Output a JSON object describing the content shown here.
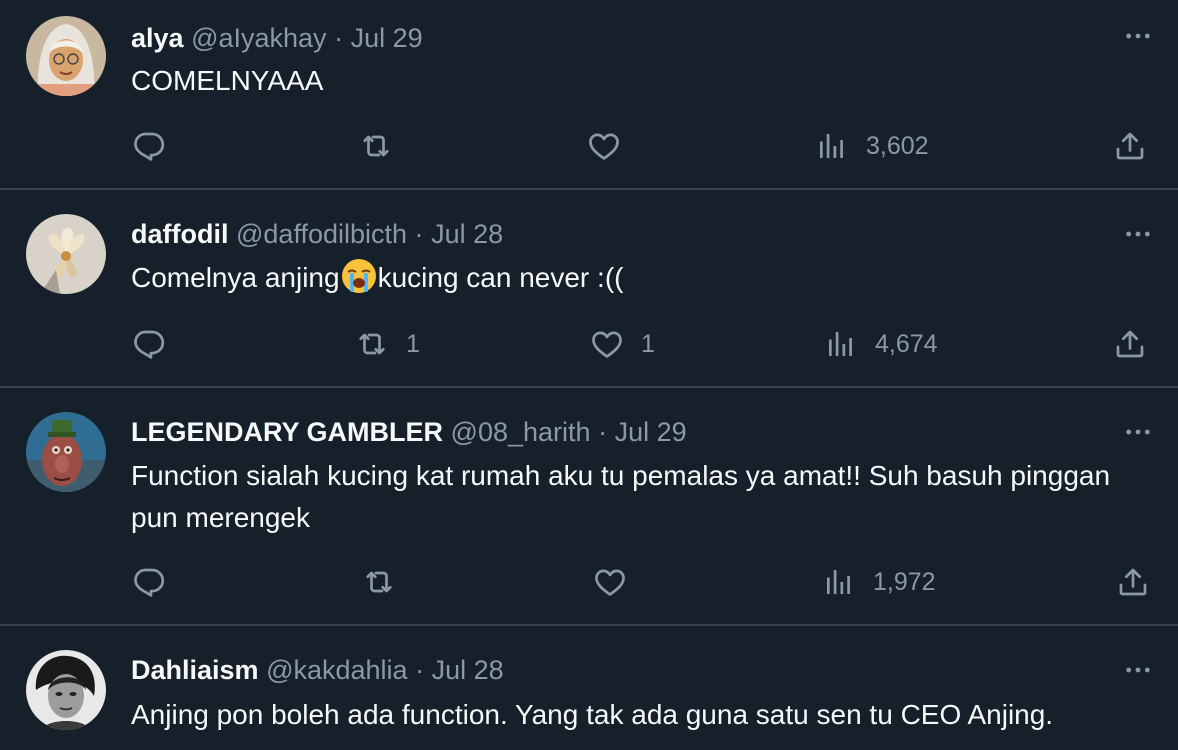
{
  "colors": {
    "background": "#15202b",
    "divider": "#38444d",
    "primary_text": "#f7f9f9",
    "secondary_text": "#8b98a5"
  },
  "tweets": [
    {
      "name": "alya",
      "handle": "@aIyakhay",
      "dot": "·",
      "date": "Jul 29",
      "text": "COMELNYAAA",
      "reply_count": "",
      "retweet_count": "",
      "like_count": "",
      "views": "3,602",
      "avatar_icon": "avatar-hijab-photo"
    },
    {
      "name": "daffodil",
      "handle": "@daffodilbicth",
      "dot": "·",
      "date": "Jul 28",
      "text_before": "Comelnya anjing",
      "emoji": "loudly-crying-face-emoji",
      "text_after": "kucing can never :((",
      "reply_count": "",
      "retweet_count": "1",
      "like_count": "1",
      "views": "4,674",
      "avatar_icon": "avatar-flower-photo"
    },
    {
      "name": "LEGENDARY GAMBLER",
      "handle": "@08_harith",
      "dot": "·",
      "date": "Jul 29",
      "text": "Function sialah kucing kat rumah aku tu pemalas ya amat!! Suh basuh pinggan pun merengek",
      "reply_count": "",
      "retweet_count": "",
      "like_count": "",
      "views": "1,972",
      "avatar_icon": "avatar-cartoon-character"
    },
    {
      "name": "Dahliaism",
      "handle": "@kakdahlia",
      "dot": "·",
      "date": "Jul 28",
      "text": "Anjing pon boleh ada function. Yang tak ada guna satu sen tu CEO Anjing.",
      "avatar_icon": "avatar-bw-portrait"
    }
  ],
  "icons": {
    "reply": "reply-icon",
    "retweet": "retweet-icon",
    "like": "heart-icon",
    "views": "views-icon",
    "share": "share-icon",
    "more": "more-options-icon"
  }
}
